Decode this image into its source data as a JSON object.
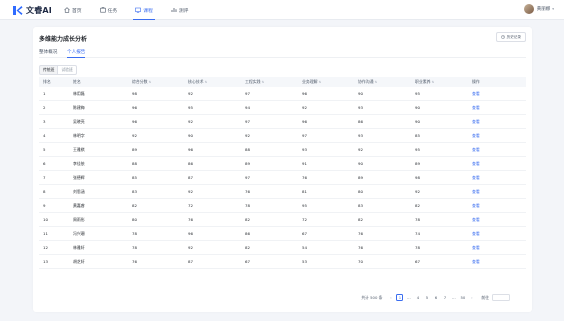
{
  "app": {
    "name": "文睿AI"
  },
  "nav": [
    {
      "label": "首页",
      "icon": "home-icon"
    },
    {
      "label": "任务",
      "icon": "task-icon"
    },
    {
      "label": "课程",
      "icon": "course-icon",
      "active": true
    },
    {
      "label": "测评",
      "icon": "chart-icon"
    }
  ],
  "user": {
    "name": "黄丽娜"
  },
  "page": {
    "title": "多维能力成长分析",
    "history_label": "历史记录",
    "tabs": [
      {
        "label": "整体概况"
      },
      {
        "label": "个人报告",
        "active": true
      }
    ],
    "segments": [
      {
        "label": "传统班"
      },
      {
        "label": "试验班"
      }
    ]
  },
  "table": {
    "headers": [
      "排名",
      "姓名",
      "综合分数",
      "核心技术",
      "工程实践",
      "业务理解",
      "协作沟通",
      "职业素养",
      "操作"
    ],
    "sortable": [
      false,
      false,
      true,
      true,
      true,
      true,
      true,
      true,
      false
    ],
    "action_label": "查看",
    "rows": [
      [
        "1",
        "林用磊",
        "98",
        "92",
        "97",
        "96",
        "90",
        "95"
      ],
      [
        "2",
        "陈建梅",
        "96",
        "95",
        "94",
        "92",
        "93",
        "90"
      ],
      [
        "3",
        "吴晓亮",
        "96",
        "92",
        "97",
        "96",
        "86",
        "90"
      ],
      [
        "4",
        "林明字",
        "92",
        "90",
        "92",
        "97",
        "93",
        "85"
      ],
      [
        "5",
        "王雅棋",
        "89",
        "96",
        "88",
        "93",
        "92",
        "95"
      ],
      [
        "6",
        "李佳依",
        "88",
        "86",
        "89",
        "91",
        "90",
        "89"
      ],
      [
        "7",
        "张德辉",
        "85",
        "87",
        "97",
        "76",
        "89",
        "98"
      ],
      [
        "8",
        "刘思涵",
        "83",
        "92",
        "76",
        "81",
        "80",
        "92"
      ],
      [
        "9",
        "黄嘉睿",
        "82",
        "72",
        "78",
        "95",
        "83",
        "82"
      ],
      [
        "10",
        "周雨彤",
        "80",
        "76",
        "82",
        "72",
        "82",
        "78"
      ],
      [
        "11",
        "冯兴珊",
        "78",
        "96",
        "86",
        "67",
        "76",
        "74"
      ],
      [
        "12",
        "林雅轩",
        "78",
        "92",
        "82",
        "54",
        "76",
        "78"
      ],
      [
        "13",
        "胡芝轩",
        "76",
        "87",
        "67",
        "53",
        "70",
        "67"
      ]
    ]
  },
  "pagination": {
    "total_label": "共计 500 条",
    "pages": [
      "1",
      "...",
      "4",
      "5",
      "6",
      "7",
      "...",
      "50"
    ],
    "current": "1",
    "goto_label": "前往"
  },
  "colors": {
    "accent": "#3a6df0",
    "background": "#f3f5f9"
  }
}
